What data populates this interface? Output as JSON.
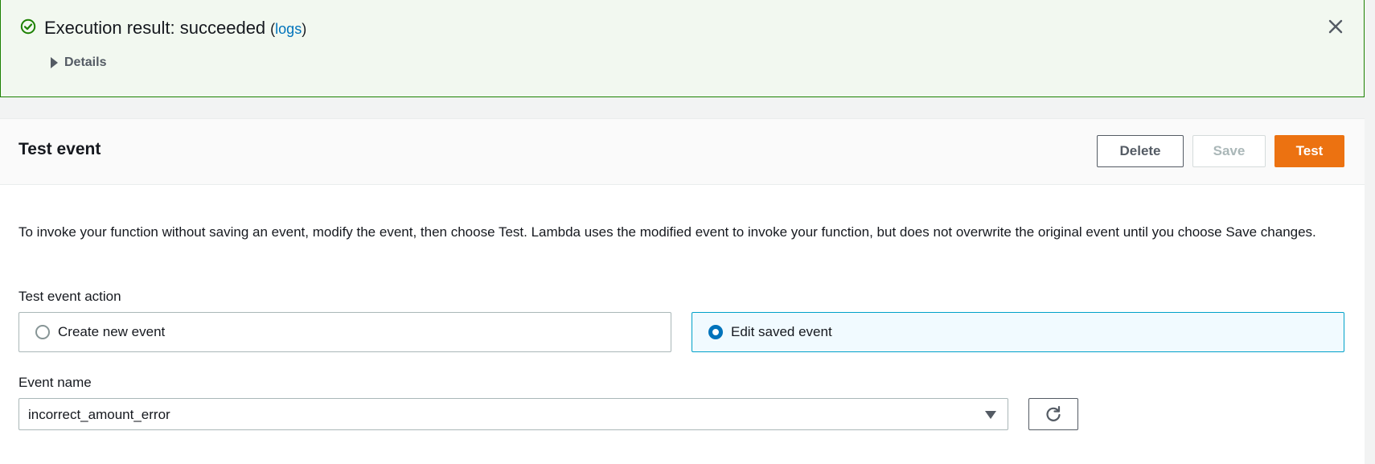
{
  "flash": {
    "title": "Execution result: succeeded",
    "logs_open": "(",
    "logs_link": "logs",
    "logs_close": ")",
    "details_label": "Details",
    "status_color": "#1d8102"
  },
  "panel": {
    "title": "Test event",
    "buttons": {
      "delete": "Delete",
      "save": "Save",
      "test": "Test"
    },
    "description": "To invoke your function without saving an event, modify the event, then choose Test. Lambda uses the modified event to invoke your function, but does not overwrite the original event until you choose Save changes.",
    "action_label": "Test event action",
    "options": [
      {
        "label": "Create new event",
        "selected": false
      },
      {
        "label": "Edit saved event",
        "selected": true
      }
    ],
    "event_name_label": "Event name",
    "event_name_value": "incorrect_amount_error",
    "accent_color": "#ec7211"
  }
}
